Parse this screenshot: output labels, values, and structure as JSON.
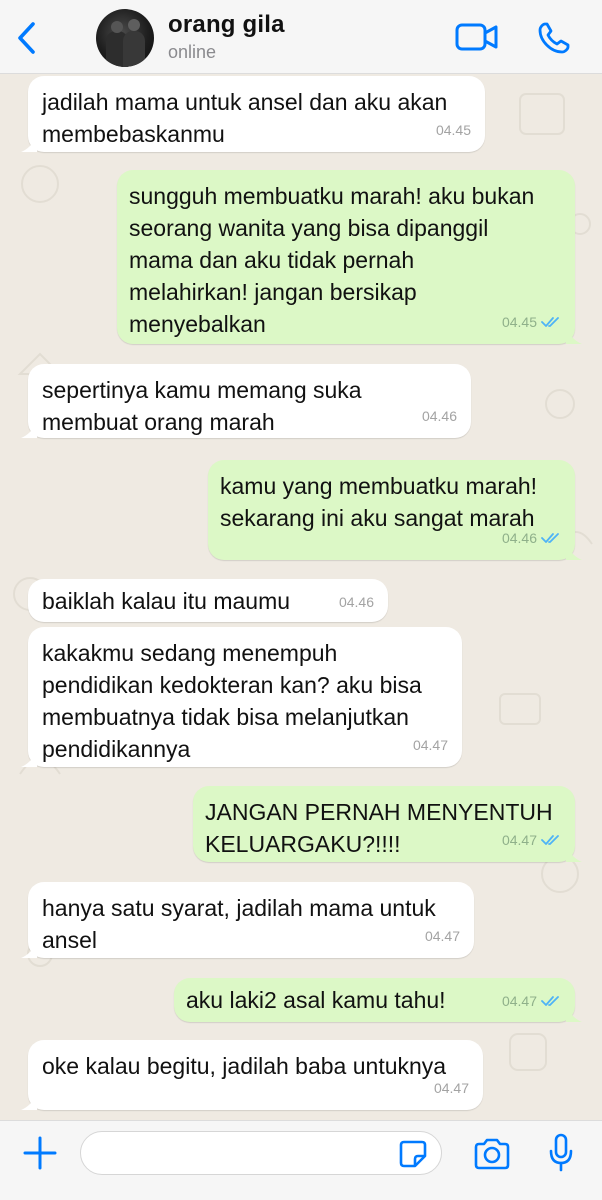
{
  "header": {
    "contact_name": "orang gila",
    "status": "online",
    "icons": {
      "back": "chevron-left-icon",
      "video": "video-camera-icon",
      "call": "phone-icon"
    }
  },
  "colors": {
    "accent": "#007aff",
    "incoming_bubble": "#ffffff",
    "outgoing_bubble": "#dcf8c6",
    "read_ticks": "#4fb3f6",
    "wallpaper": "#efeae2"
  },
  "messages": [
    {
      "direction": "in",
      "text": "jadilah mama untuk ansel dan aku akan\nmembebaskanmu",
      "time": "04.45"
    },
    {
      "direction": "out",
      "text": "sungguh membuatku marah! aku bukan\nseorang wanita yang bisa dipanggil\nmama dan aku tidak pernah\nmelahirkan! jangan bersikap\nmenyebalkan",
      "time": "04.45",
      "read": true
    },
    {
      "direction": "in",
      "text": "sepertinya kamu memang suka\nmembuat orang marah",
      "time": "04.46"
    },
    {
      "direction": "out",
      "text": "kamu yang membuatku marah!\nsekarang ini aku sangat marah",
      "time": "04.46",
      "read": true
    },
    {
      "direction": "in",
      "text": "baiklah kalau itu maumu",
      "time": "04.46"
    },
    {
      "direction": "in",
      "text": "kakakmu sedang menempuh\npendidikan kedokteran kan? aku bisa\nmembuatnya tidak bisa melanjutkan\npendidikannya",
      "time": "04.47"
    },
    {
      "direction": "out",
      "text": "JANGAN PERNAH MENYENTUH\nKELUARGAKU?!!!!",
      "time": "04.47",
      "read": true
    },
    {
      "direction": "in",
      "text": "hanya satu syarat, jadilah mama untuk\nansel",
      "time": "04.47"
    },
    {
      "direction": "out",
      "text": "aku laki2 asal kamu tahu!",
      "time": "04.47",
      "read": true
    },
    {
      "direction": "in",
      "text": "oke kalau begitu, jadilah baba untuknya",
      "time": "04.47"
    }
  ],
  "composer": {
    "value": "",
    "placeholder": "",
    "icons": {
      "attach": "plus-icon",
      "sticker": "sticker-icon",
      "camera": "camera-icon",
      "mic": "microphone-icon"
    }
  }
}
